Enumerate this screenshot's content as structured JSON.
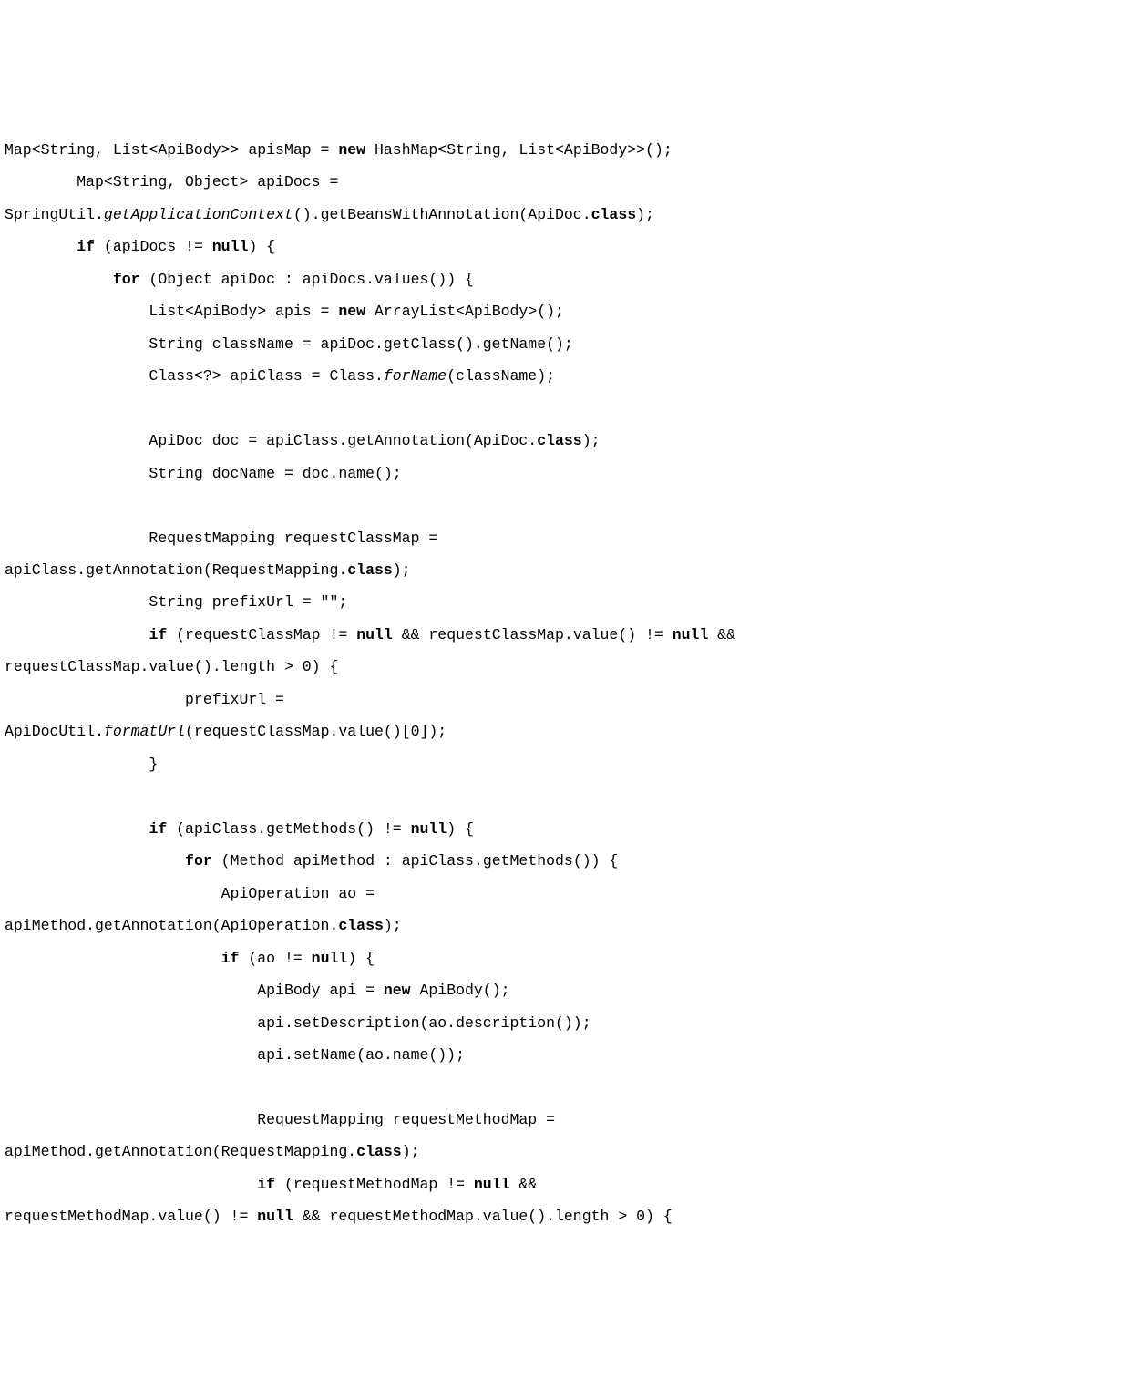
{
  "code": {
    "tokens": [
      {
        "t": "Map<String, List<ApiBody>> apisMap = "
      },
      {
        "t": "new",
        "c": "kw"
      },
      {
        "t": " HashMap<String, List<ApiBody>>();\n"
      },
      {
        "t": "        Map<String, Object> apiDocs = \n"
      },
      {
        "t": "SpringUtil."
      },
      {
        "t": "getApplicationContext",
        "c": "it"
      },
      {
        "t": "().getBeansWithAnnotation(ApiDoc."
      },
      {
        "t": "class",
        "c": "kw"
      },
      {
        "t": ");\n"
      },
      {
        "t": "        "
      },
      {
        "t": "if",
        "c": "kw"
      },
      {
        "t": " (apiDocs != "
      },
      {
        "t": "null",
        "c": "kw"
      },
      {
        "t": ") {\n"
      },
      {
        "t": "            "
      },
      {
        "t": "for",
        "c": "kw"
      },
      {
        "t": " (Object apiDoc : apiDocs.values()) {\n"
      },
      {
        "t": "                List<ApiBody> apis = "
      },
      {
        "t": "new",
        "c": "kw"
      },
      {
        "t": " ArrayList<ApiBody>();\n"
      },
      {
        "t": "                String className = apiDoc.getClass().getName();\n"
      },
      {
        "t": "                Class<?> apiClass = Class."
      },
      {
        "t": "forName",
        "c": "it"
      },
      {
        "t": "(className);\n"
      },
      {
        "t": "\n"
      },
      {
        "t": "                ApiDoc doc = apiClass.getAnnotation(ApiDoc."
      },
      {
        "t": "class",
        "c": "kw"
      },
      {
        "t": ");\n"
      },
      {
        "t": "                String docName = doc.name();\n"
      },
      {
        "t": "\n"
      },
      {
        "t": "                RequestMapping requestClassMap = \n"
      },
      {
        "t": "apiClass.getAnnotation(RequestMapping."
      },
      {
        "t": "class",
        "c": "kw"
      },
      {
        "t": ");\n"
      },
      {
        "t": "                String prefixUrl = \"\";\n"
      },
      {
        "t": "                "
      },
      {
        "t": "if",
        "c": "kw"
      },
      {
        "t": " (requestClassMap != "
      },
      {
        "t": "null",
        "c": "kw"
      },
      {
        "t": " && requestClassMap.value() != "
      },
      {
        "t": "null",
        "c": "kw"
      },
      {
        "t": " && \n"
      },
      {
        "t": "requestClassMap.value().length > 0) {\n"
      },
      {
        "t": "                    prefixUrl = \n"
      },
      {
        "t": "ApiDocUtil."
      },
      {
        "t": "formatUrl",
        "c": "it"
      },
      {
        "t": "(requestClassMap.value()[0]);\n"
      },
      {
        "t": "                }\n"
      },
      {
        "t": "\n"
      },
      {
        "t": "                "
      },
      {
        "t": "if",
        "c": "kw"
      },
      {
        "t": " (apiClass.getMethods() != "
      },
      {
        "t": "null",
        "c": "kw"
      },
      {
        "t": ") {\n"
      },
      {
        "t": "                    "
      },
      {
        "t": "for",
        "c": "kw"
      },
      {
        "t": " (Method apiMethod : apiClass.getMethods()) {\n"
      },
      {
        "t": "                        ApiOperation ao = \n"
      },
      {
        "t": "apiMethod.getAnnotation(ApiOperation."
      },
      {
        "t": "class",
        "c": "kw"
      },
      {
        "t": ");\n"
      },
      {
        "t": "                        "
      },
      {
        "t": "if",
        "c": "kw"
      },
      {
        "t": " (ao != "
      },
      {
        "t": "null",
        "c": "kw"
      },
      {
        "t": ") {\n"
      },
      {
        "t": "                            ApiBody api = "
      },
      {
        "t": "new",
        "c": "kw"
      },
      {
        "t": " ApiBody();\n"
      },
      {
        "t": "                            api.setDescription(ao.description());\n"
      },
      {
        "t": "                            api.setName(ao.name());\n"
      },
      {
        "t": "\n"
      },
      {
        "t": "                            RequestMapping requestMethodMap = \n"
      },
      {
        "t": "apiMethod.getAnnotation(RequestMapping."
      },
      {
        "t": "class",
        "c": "kw"
      },
      {
        "t": ");\n"
      },
      {
        "t": "                            "
      },
      {
        "t": "if",
        "c": "kw"
      },
      {
        "t": " (requestMethodMap != "
      },
      {
        "t": "null",
        "c": "kw"
      },
      {
        "t": " && \n"
      },
      {
        "t": "requestMethodMap.value() != "
      },
      {
        "t": "null",
        "c": "kw"
      },
      {
        "t": " && requestMethodMap.value().length > 0) {\n"
      }
    ]
  }
}
